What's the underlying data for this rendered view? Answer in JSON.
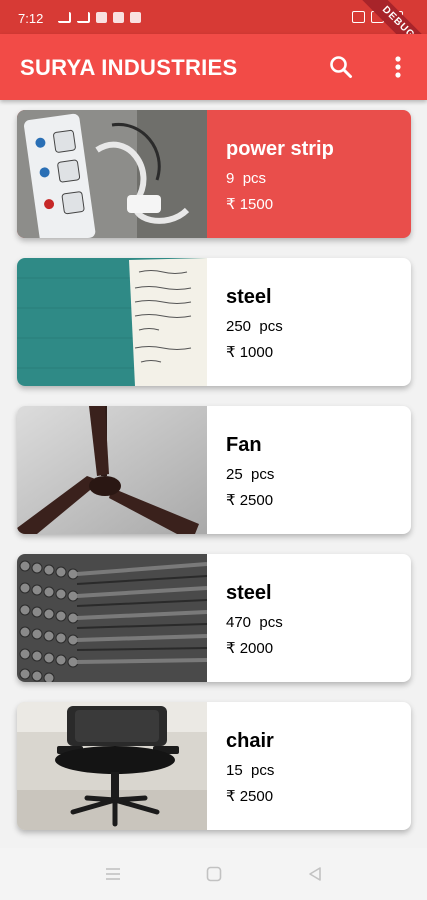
{
  "status_bar": {
    "time": "7:12"
  },
  "debug_banner": "DEBUG",
  "app_bar": {
    "title": "SURYA INDUSTRIES",
    "search_icon": "search-icon",
    "menu_icon": "more-vert-icon"
  },
  "products": [
    {
      "name": "power strip",
      "qty": "9",
      "unit": "pcs",
      "currency": "₹",
      "price": "1500",
      "selected": true
    },
    {
      "name": "steel",
      "qty": "250",
      "unit": "pcs",
      "currency": "₹",
      "price": "1000",
      "selected": false
    },
    {
      "name": "Fan",
      "qty": "25",
      "unit": "pcs",
      "currency": "₹",
      "price": "2500",
      "selected": false
    },
    {
      "name": "steel",
      "qty": "470",
      "unit": "pcs",
      "currency": "₹",
      "price": "2000",
      "selected": false
    },
    {
      "name": "chair",
      "qty": "15",
      "unit": "pcs",
      "currency": "₹",
      "price": "2500",
      "selected": false
    }
  ],
  "colors": {
    "app_bar": "#f24b47",
    "status_bar": "#d73a35",
    "selected_card": "#e94e4b"
  }
}
